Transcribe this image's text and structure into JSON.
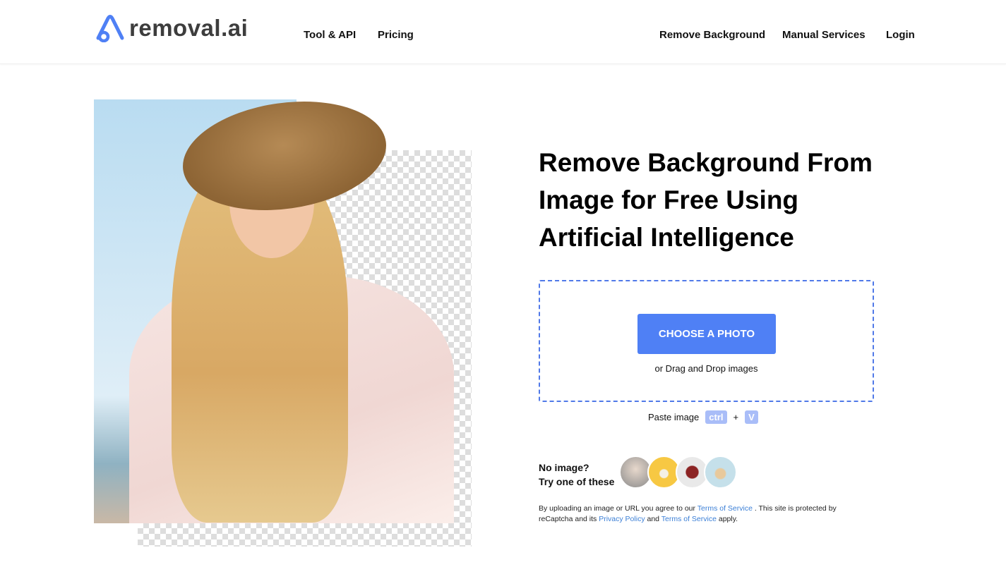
{
  "header": {
    "logo_text": "removal.ai",
    "nav_left": [
      "Tool & API",
      "Pricing"
    ],
    "nav_right": [
      "Remove Background",
      "Manual Services",
      "Login"
    ]
  },
  "hero": {
    "title": "Remove Background From Image for Free Using Artificial Intelligence"
  },
  "upload": {
    "button": "CHOOSE A PHOTO",
    "drag_text": "or Drag and Drop images",
    "paste_label": "Paste image",
    "key_ctrl": "ctrl",
    "plus": "+",
    "key_v": "V"
  },
  "samples": {
    "line1": "No image?",
    "line2": "Try one of these",
    "items": [
      "family",
      "car",
      "backpack",
      "dog"
    ]
  },
  "legal": {
    "t1": "By uploading an image or URL you agree to our ",
    "tos1": "Terms of Service",
    "t2": " . This site is protected by reCaptcha and its ",
    "privacy": "Privacy Policy",
    "t3": " and ",
    "tos2": "Terms of Service",
    "t4": " apply."
  },
  "colors": {
    "accent": "#4f80f5",
    "link": "#3b7fd6",
    "key": "#a9bdf8"
  }
}
